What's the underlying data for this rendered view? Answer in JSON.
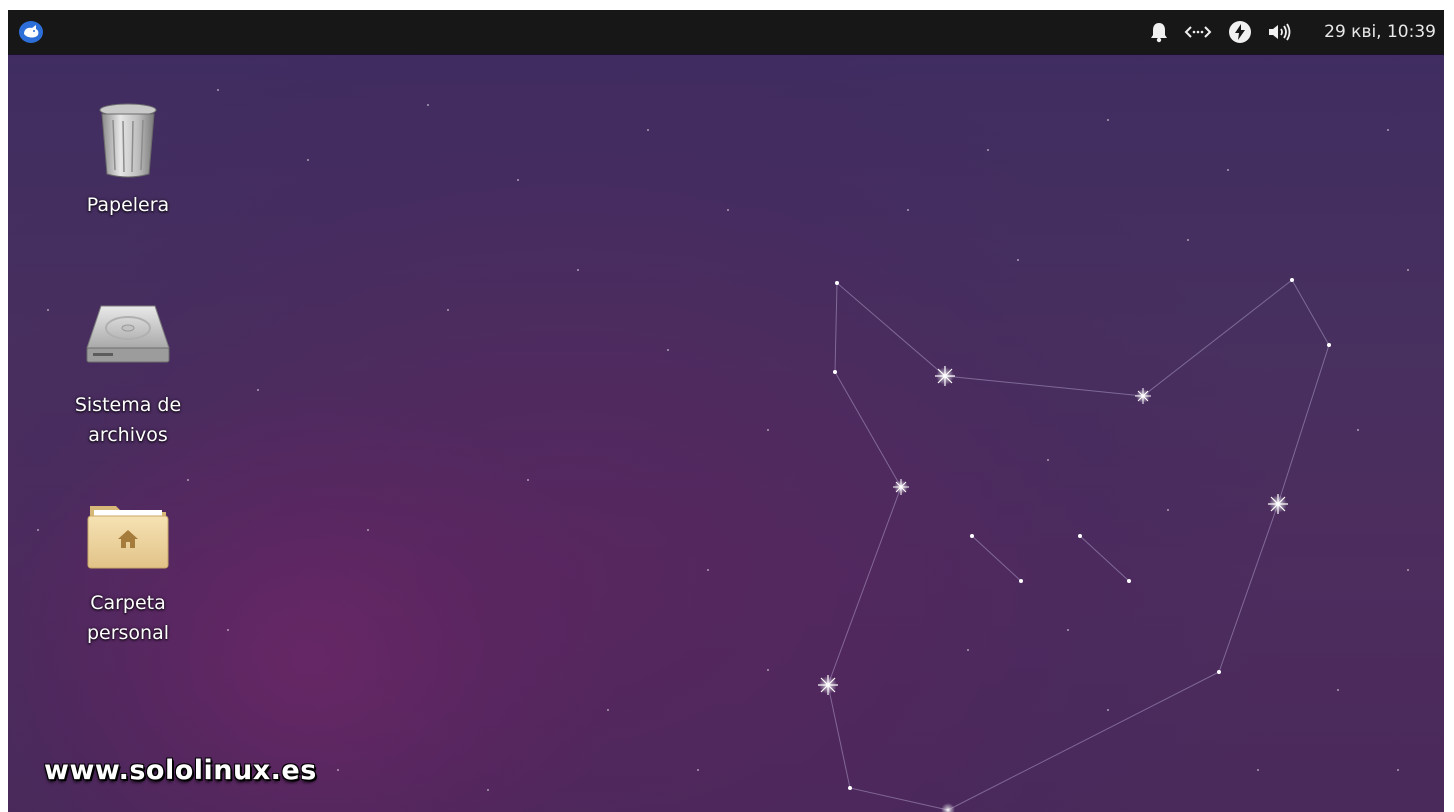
{
  "panel": {
    "menu_button": {
      "icon": "xfce-mouse-icon"
    },
    "tray": [
      {
        "icon": "bell-icon"
      },
      {
        "icon": "network-icon"
      },
      {
        "icon": "power-icon"
      },
      {
        "icon": "volume-icon"
      }
    ],
    "clock": "29 кві, 10:39"
  },
  "desktop": {
    "icons": [
      {
        "icon": "trash-icon",
        "label_lines": [
          "Papelera"
        ]
      },
      {
        "icon": "hard-drive-icon",
        "label_lines": [
          "Sistema de",
          "archivos"
        ]
      },
      {
        "icon": "home-folder-icon",
        "label_lines": [
          "Carpeta",
          "personal"
        ]
      }
    ]
  },
  "watermark": "www.sololinux.es",
  "colors": {
    "panel_bg": "#171717",
    "wallpaper": "#46305f",
    "label_text": "#ffffff"
  }
}
